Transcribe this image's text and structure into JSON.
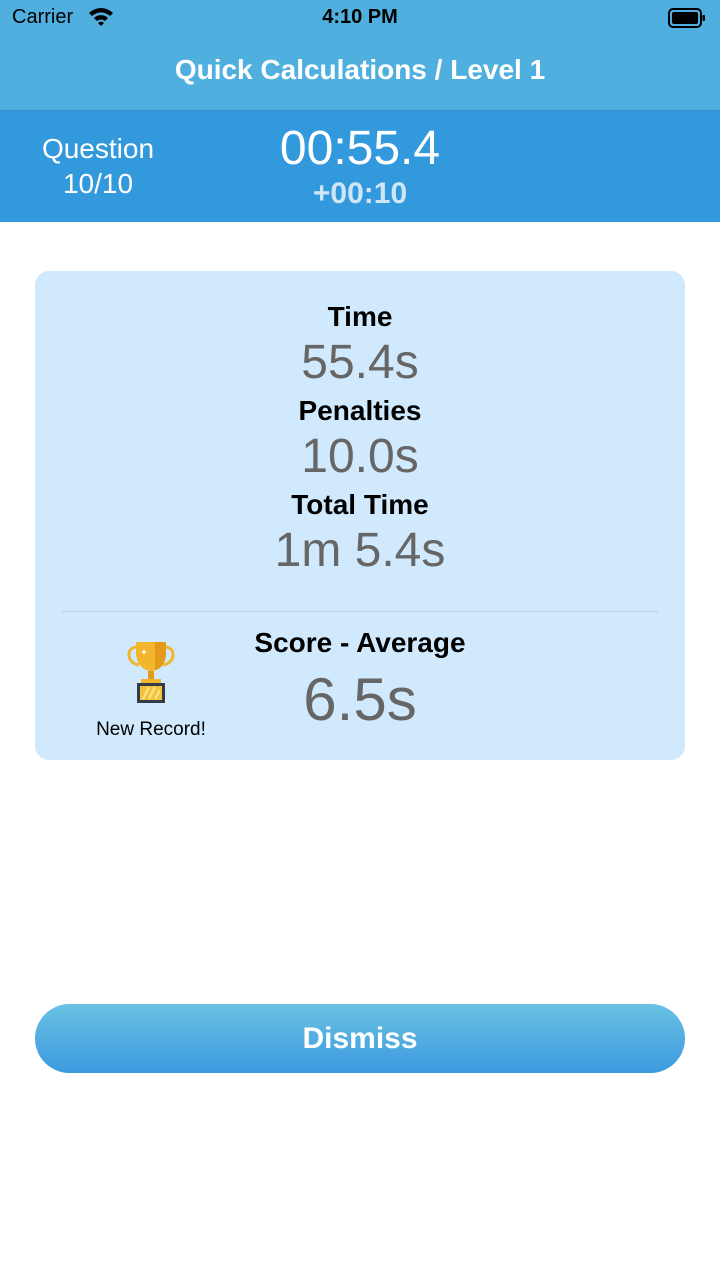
{
  "status_bar": {
    "carrier": "Carrier",
    "time": "4:10 PM",
    "wifi_icon": "wifi-icon",
    "battery_icon": "battery-icon"
  },
  "nav": {
    "title": "Quick Calculations / Level 1"
  },
  "info_bar": {
    "question_label": "Question",
    "question_value": "10/10",
    "timer": "00:55.4",
    "penalty": "+00:10"
  },
  "results": {
    "time_label": "Time",
    "time_value": "55.4s",
    "penalties_label": "Penalties",
    "penalties_value": "10.0s",
    "total_label": "Total Time",
    "total_value": "1m 5.4s",
    "score_label": "Score - Average",
    "score_value": "6.5s",
    "record_icon": "trophy-icon",
    "record_label": "New Record!"
  },
  "actions": {
    "dismiss_label": "Dismiss"
  },
  "colors": {
    "nav_background": "#4fb0e0",
    "info_bar_background": "#3399dd",
    "card_background": "#d0e9fc",
    "value_text": "#666666",
    "button_gradient_top": "#6ac2e4",
    "button_gradient_bottom": "#3c9ade"
  }
}
